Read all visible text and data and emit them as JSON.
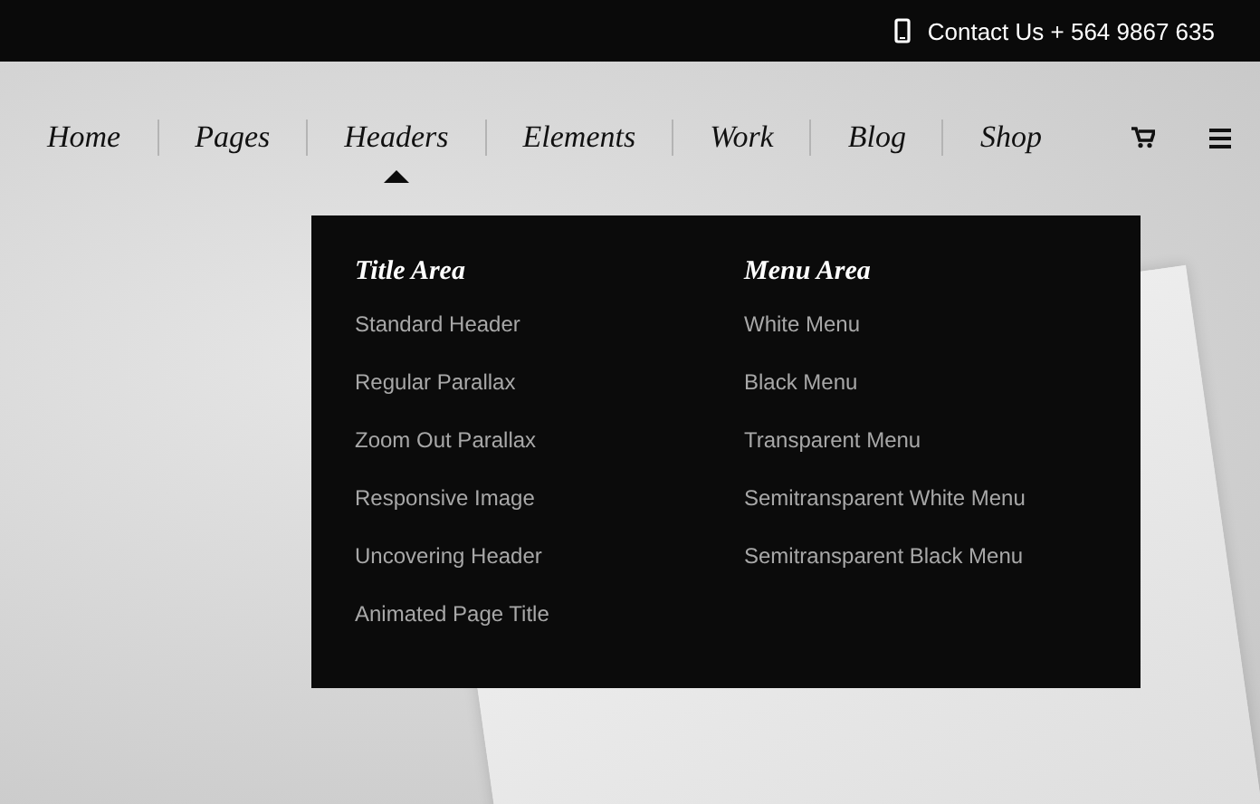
{
  "top_bar": {
    "contact": "Contact Us + 564 9867 635"
  },
  "nav": {
    "items": [
      {
        "label": "Home",
        "selected": false
      },
      {
        "label": "Pages",
        "selected": false
      },
      {
        "label": "Headers",
        "selected": true
      },
      {
        "label": "Elements",
        "selected": false
      },
      {
        "label": "Work",
        "selected": false
      },
      {
        "label": "Blog",
        "selected": false
      },
      {
        "label": "Shop",
        "selected": false
      }
    ]
  },
  "dropdown": {
    "columns": [
      {
        "heading": "Title Area",
        "items": [
          "Standard Header",
          "Regular Parallax",
          "Zoom Out Parallax",
          "Responsive Image",
          "Uncovering Header",
          "Animated Page Title"
        ]
      },
      {
        "heading": "Menu Area",
        "items": [
          "White Menu",
          "Black Menu",
          "Transparent Menu",
          "Semitransparent White Menu",
          "Semitransparent Black Menu"
        ]
      }
    ]
  }
}
